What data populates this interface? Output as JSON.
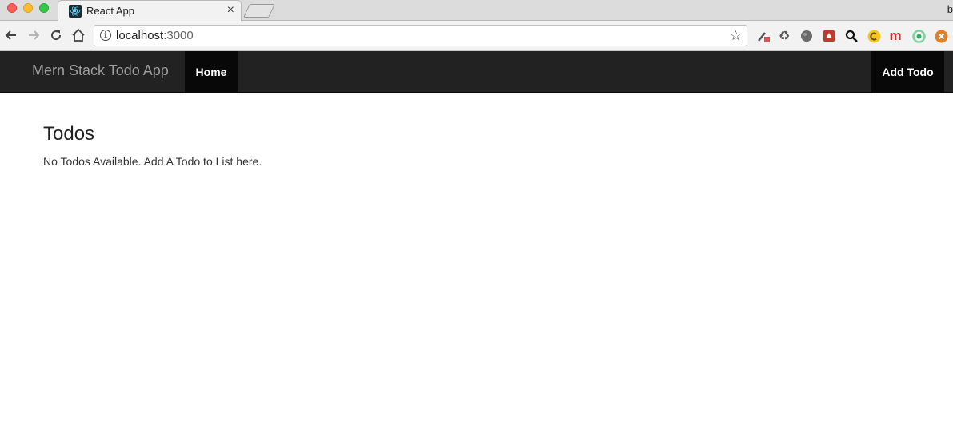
{
  "browser": {
    "tab": {
      "title": "React App",
      "favicon": "react-icon",
      "close_glyph": "×"
    },
    "profile_initial": "b",
    "address_bar": {
      "host": "localhost",
      "port": ":3000",
      "info_glyph": "i",
      "star_glyph": "☆"
    },
    "nav": {
      "back_glyph": "←",
      "forward_glyph": "→",
      "reload_glyph": "↻"
    },
    "extensions": [
      {
        "name": "tools-extension-icon",
        "glyph": "✕",
        "color": "#c44"
      },
      {
        "name": "recycle-extension-icon",
        "glyph": "♻",
        "color": "#555"
      },
      {
        "name": "globe-extension-icon",
        "glyph": "●",
        "color": "#666"
      },
      {
        "name": "red-square-extension-icon",
        "glyph": "■",
        "color": "#c0392b"
      },
      {
        "name": "magnifier-extension-icon",
        "glyph": "⚲",
        "color": "#111"
      },
      {
        "name": "yellow-c-extension-icon",
        "glyph": "C",
        "color": "#e6a700"
      },
      {
        "name": "m-extension-icon",
        "glyph": "m",
        "color": "#d0312d"
      },
      {
        "name": "green-ring-extension-icon",
        "glyph": "◎",
        "color": "#3aa76d"
      },
      {
        "name": "orange-x-extension-icon",
        "glyph": "⊗",
        "color": "#e67e22"
      }
    ]
  },
  "navbar": {
    "brand": "Mern Stack Todo App",
    "home_label": "Home",
    "add_label": "Add Todo"
  },
  "main": {
    "title": "Todos",
    "empty_message": "No Todos Available. Add A Todo to List here."
  }
}
